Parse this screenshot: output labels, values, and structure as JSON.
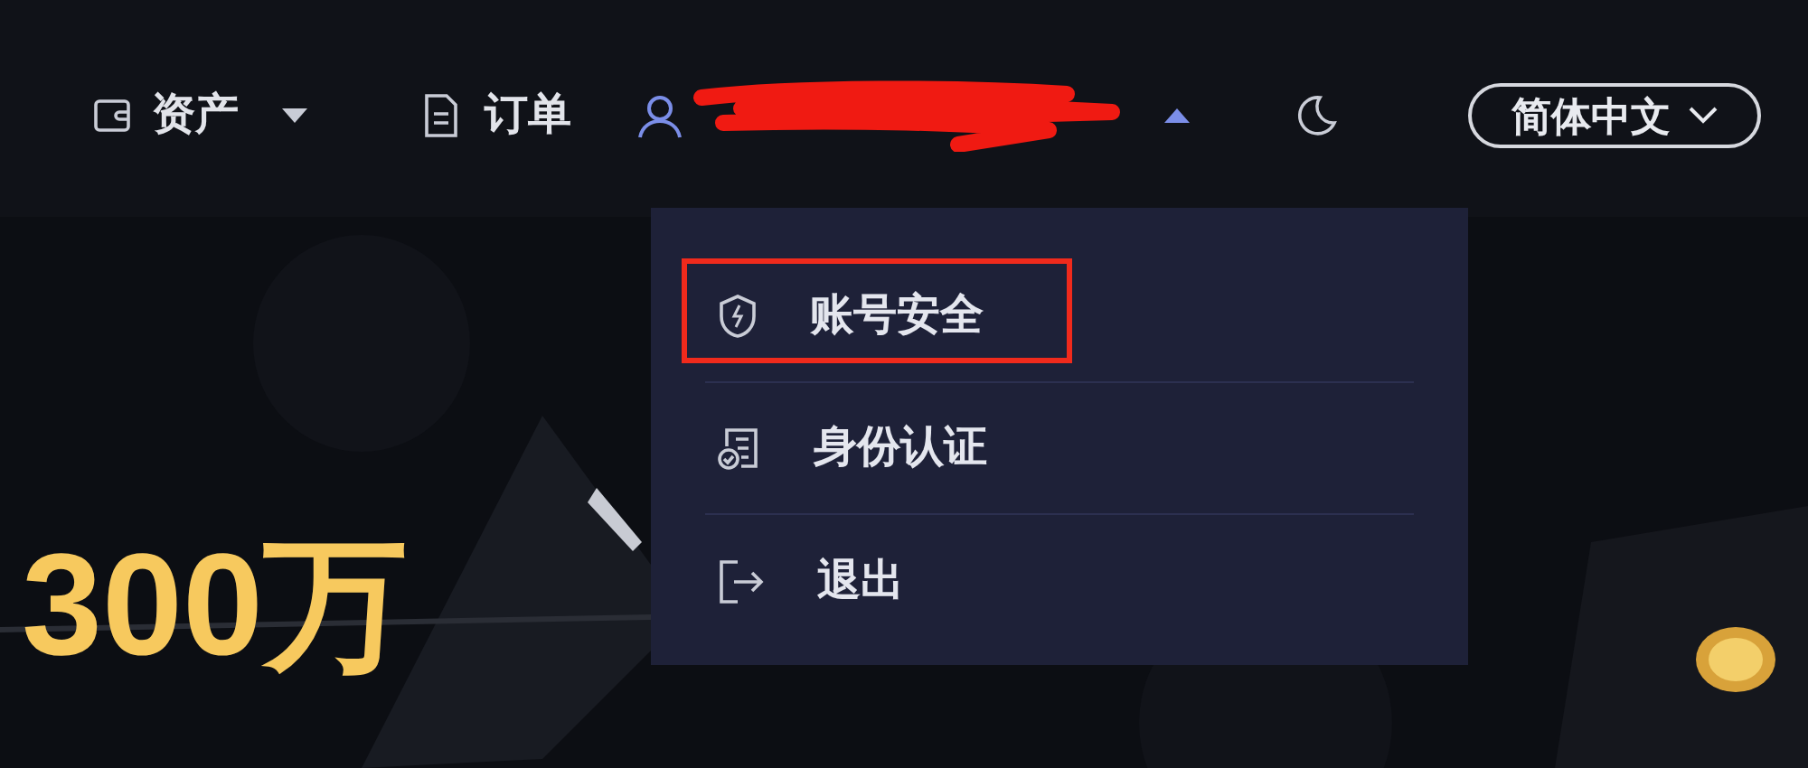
{
  "nav": {
    "assets": {
      "label": "资产"
    },
    "orders": {
      "label": "订单"
    },
    "account": {
      "redacted": true,
      "expanded": true
    },
    "language": {
      "label": "简体中文"
    }
  },
  "account_menu": [
    {
      "kind": "security",
      "label": "账号安全",
      "annotated": true
    },
    {
      "kind": "verification",
      "label": "身份认证",
      "annotated": false
    },
    {
      "kind": "logout",
      "label": "退出",
      "annotated": false
    }
  ],
  "banner": {
    "headline": "300万"
  }
}
